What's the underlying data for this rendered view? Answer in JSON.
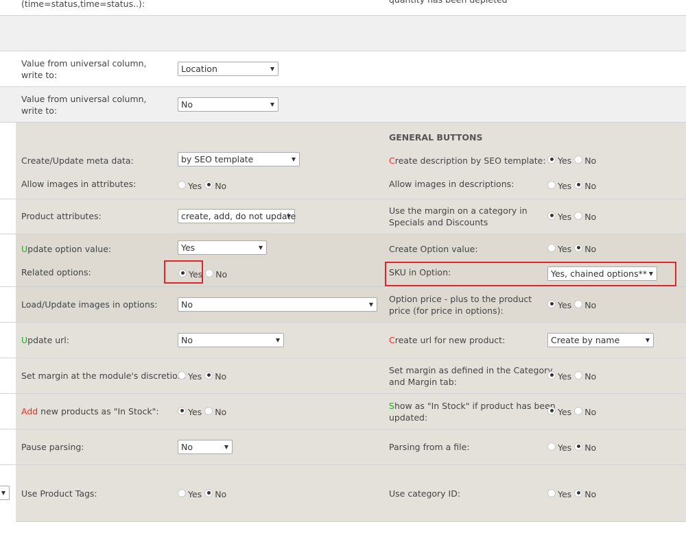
{
  "top": {
    "left_text": "(time=status,time=status..):",
    "right_text": "quantity has been depleted"
  },
  "universal_rows": [
    {
      "label": "Value from universal column, write to:",
      "value": "Location"
    },
    {
      "label": "Value from universal column, write to:",
      "value": "No"
    }
  ],
  "general_header": "GENERAL BUTTONS",
  "left": {
    "meta": {
      "label": "Create/Update meta data:",
      "value": "by SEO template"
    },
    "allow_images_attr": {
      "label": "Allow images in attributes:",
      "yes": "Yes",
      "no": "No",
      "selected": "No"
    },
    "product_attr": {
      "label": "Product attributes:",
      "value": "create, add, do not update"
    },
    "update_option": {
      "first": "U",
      "rest": "pdate option value:",
      "value": "Yes"
    },
    "related_options": {
      "label": "Related options:",
      "yes": "Yes",
      "no": "No",
      "selected": "Yes"
    },
    "load_images": {
      "label": "Load/Update images in options:",
      "value": "No"
    },
    "update_url": {
      "first": "U",
      "rest": "pdate url:",
      "value": "No"
    },
    "set_margin": {
      "label": "Set margin at the module's discretion:",
      "yes": "Yes",
      "no": "No",
      "selected": "No"
    },
    "add_products": {
      "first": "Add",
      "rest": " new products as \"In Stock\":",
      "yes": "Yes",
      "no": "No",
      "selected": "Yes"
    },
    "pause": {
      "label": "Pause parsing:",
      "value": "No"
    },
    "tags": {
      "label": "Use Product Tags:",
      "yes": "Yes",
      "no": "No",
      "selected": "No"
    }
  },
  "right": {
    "desc_seo": {
      "first": "C",
      "rest": "reate description by SEO template:",
      "yes": "Yes",
      "no": "No",
      "selected": "Yes"
    },
    "allow_images_desc": {
      "label": "Allow images in descriptions:",
      "yes": "Yes",
      "no": "No",
      "selected": "No"
    },
    "margin_specials": {
      "line1": "Use the margin on a category in",
      "line2": "Specials and Discounts",
      "yes": "Yes",
      "no": "No",
      "selected": "Yes"
    },
    "create_option": {
      "label": "Create Option value:",
      "yes": "Yes",
      "no": "No",
      "selected": "No"
    },
    "sku": {
      "label": "SKU in Option:",
      "value": "Yes, chained options**"
    },
    "option_price": {
      "line1": "Option price - plus to the product",
      "line2": "price (for price in options):",
      "yes": "Yes",
      "no": "No",
      "selected": "Yes"
    },
    "create_url": {
      "first": "C",
      "rest": "reate url for new product:",
      "value": "Create by name"
    },
    "margin_category": {
      "line1": "Set margin as defined in the Category",
      "line2": "and Margin tab:",
      "yes": "Yes",
      "no": "No",
      "selected": "Yes"
    },
    "show_stock": {
      "first": "S",
      "line1rest": "how as \"In Stock\" if product has been",
      "line2": "updated:",
      "yes": "Yes",
      "no": "No",
      "selected": "Yes"
    },
    "parsing_file": {
      "label": "Parsing from a file:",
      "yes": "Yes",
      "no": "No",
      "selected": "No"
    },
    "category_id": {
      "label": "Use category ID:",
      "yes": "Yes",
      "no": "No",
      "selected": "No"
    }
  },
  "colors": {
    "panel": "#e4e1da",
    "grey_band": "#f0f0f0",
    "accent_red": "#e0302a",
    "accent_green": "#2ea32e",
    "highlight_box": "#e0242a"
  }
}
